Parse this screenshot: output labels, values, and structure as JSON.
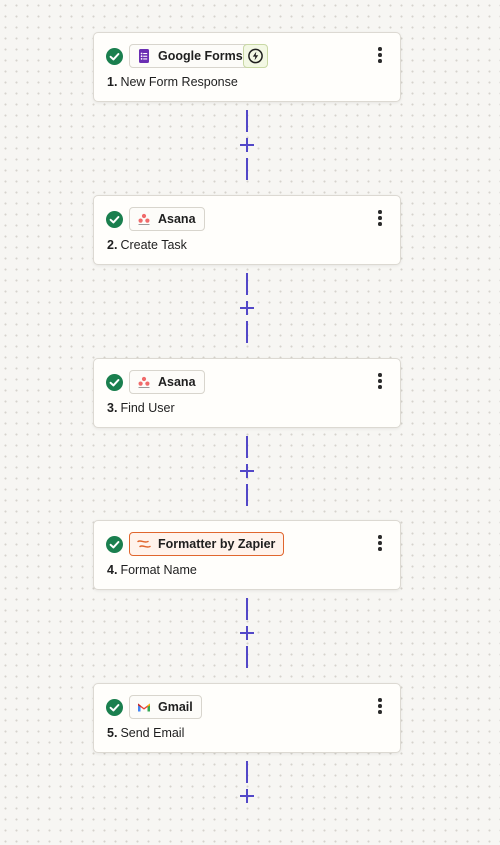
{
  "colors": {
    "success": "#1a7f4e",
    "connector": "#5348c8",
    "formatter_accent": "#e0662e",
    "google_forms": "#6b2fb3",
    "asana": "#f06a6a"
  },
  "steps": [
    {
      "app": "Google Forms",
      "icon": "google-forms-icon",
      "number": "1.",
      "title": "New Form Response",
      "status": "success",
      "has_trigger_badge": true
    },
    {
      "app": "Asana",
      "icon": "asana-icon",
      "number": "2.",
      "title": "Create Task",
      "status": "success"
    },
    {
      "app": "Asana",
      "icon": "asana-icon",
      "number": "3.",
      "title": "Find User",
      "status": "success"
    },
    {
      "app": "Formatter by Zapier",
      "icon": "formatter-icon",
      "number": "4.",
      "title": "Format Name",
      "status": "success"
    },
    {
      "app": "Gmail",
      "icon": "gmail-icon",
      "number": "5.",
      "title": "Send Email",
      "status": "success"
    }
  ],
  "connectors": [
    {
      "icon": "plus-icon"
    },
    {
      "icon": "plus-icon"
    },
    {
      "icon": "plus-icon"
    },
    {
      "icon": "plus-icon"
    },
    {
      "icon": "plus-icon"
    }
  ]
}
